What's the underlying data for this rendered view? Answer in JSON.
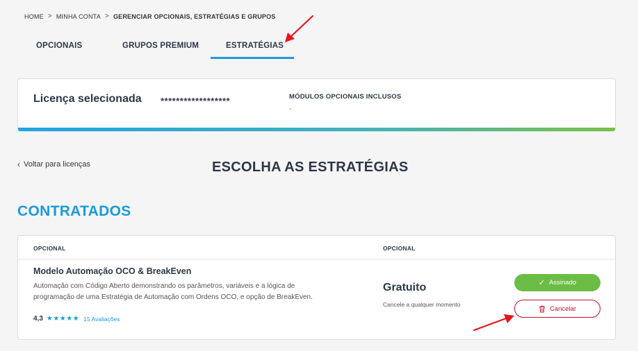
{
  "breadcrumb": {
    "home": "HOME",
    "account": "MINHA CONTA",
    "current": "GERENCIAR OPCIONAIS, ESTRATÉGIAS E GRUPOS",
    "separator": ">"
  },
  "tabs": [
    {
      "label": "OPCIONAIS"
    },
    {
      "label": "GRUPOS PREMIUM"
    },
    {
      "label": "ESTRATÉGIAS",
      "active": true
    }
  ],
  "license": {
    "title": "Licença selecionada",
    "key": "******************",
    "modules_label": "MÓDULOS OPCIONAIS INCLUSOS",
    "modules_value": "-"
  },
  "back_link": "Voltar para licenças",
  "page_title": "ESCOLHA AS ESTRATÉGIAS",
  "section_title": "CONTRATADOS",
  "table": {
    "headers": [
      "OPCIONAL",
      "OPCIONAL"
    ],
    "rows": [
      {
        "name": "Modelo Automação OCO & BreakEven",
        "description": "Automação com Código Aberto demonstrando os parâmetros, variáveis e a lógica de programação de uma Estratégia de Automação com Ordens OCO, e opção de BreakEven.",
        "rating": "4,3",
        "stars": "★★★★★",
        "reviews": "15 Avaliações",
        "price": "Gratuito",
        "price_note": "Cancele a qualquer momento",
        "signed_label": "Assinado",
        "cancel_label": "Cancelar"
      }
    ]
  },
  "colors": {
    "accent": "#1a9bd8",
    "success": "#6cbd45",
    "danger": "#c8102e",
    "annotation_arrow": "#e8141c"
  },
  "icons": {
    "check": "check-icon",
    "trash": "trash-icon",
    "back": "chevron-left-icon",
    "star": "star-icon"
  }
}
